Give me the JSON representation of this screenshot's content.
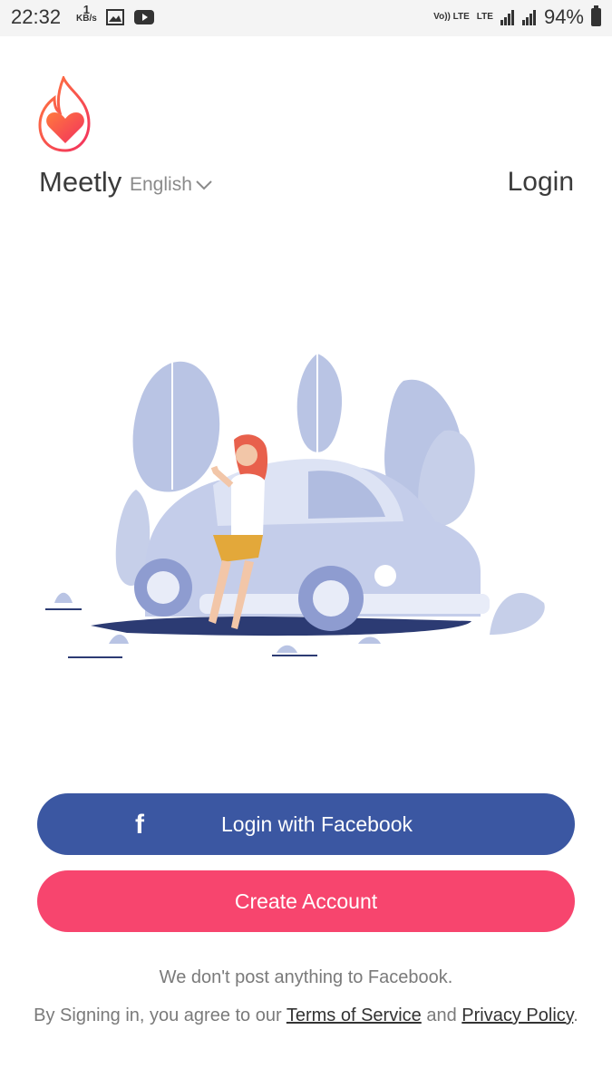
{
  "status_bar": {
    "time": "22:32",
    "speed_value": "1",
    "speed_unit": "KB/s",
    "volte": "Vo)) LTE",
    "lte": "LTE",
    "battery": "94%"
  },
  "header": {
    "app_name": "Meetly",
    "language": "English",
    "login": "Login"
  },
  "buttons": {
    "facebook_label": "Login with Facebook",
    "create_label": "Create Account"
  },
  "footer": {
    "note": "We don't post anything to Facebook.",
    "agree_prefix": "By Signing in, you agree to our",
    "terms": "Terms of Service",
    "and": "and",
    "privacy": "Privacy Policy",
    "suffix": "."
  },
  "colors": {
    "facebook": "#3b57a2",
    "create": "#f7456e",
    "illustration": "#b9c4e4"
  }
}
